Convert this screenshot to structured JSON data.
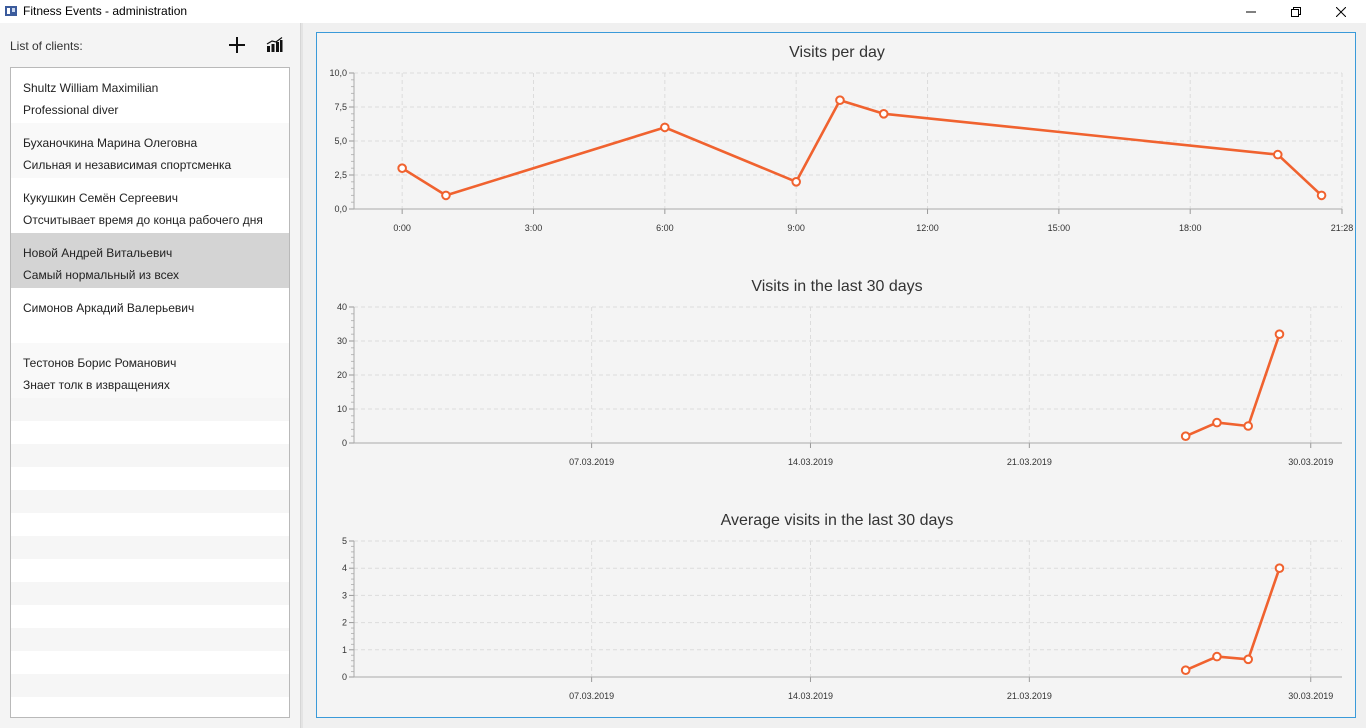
{
  "window": {
    "title": "Fitness Events - administration",
    "icon": "app-icon"
  },
  "sidebar": {
    "label": "List of clients:",
    "add_icon": "plus-icon",
    "stats_icon": "bar-chart-icon",
    "clients": [
      {
        "name": "Shultz William Maximilian",
        "note": "Professional diver",
        "selected": false
      },
      {
        "name": "Буханочкина Марина Олеговна",
        "note": "Сильная и независимая спортсменка",
        "selected": false
      },
      {
        "name": "Кукушкин Семён Сергеевич",
        "note": "Отсчитывает время до конца рабочего дня",
        "selected": false
      },
      {
        "name": "Новой Андрей Витальевич",
        "note": "Самый нормальный из всех",
        "selected": true
      },
      {
        "name": "Симонов Аркадий Валерьевич",
        "note": "",
        "selected": false
      },
      {
        "name": "Тестонов Борис Романович",
        "note": "Знает толк в извращениях",
        "selected": false
      }
    ]
  },
  "colors": {
    "series": "#f0622f",
    "panel_border": "#3a9ad9",
    "selected_row": "#d4d4d4"
  },
  "chart_data": [
    {
      "type": "line",
      "title": "Visits per day",
      "x_kind": "time",
      "x": [
        "0:00",
        "1:00",
        "6:00",
        "9:00",
        "10:00",
        "11:00",
        "20:00",
        "21:00"
      ],
      "y": [
        3,
        1,
        6,
        2,
        8,
        7,
        4,
        1
      ],
      "x_ticks": [
        "0:00",
        "3:00",
        "6:00",
        "9:00",
        "12:00",
        "15:00",
        "18:00",
        "21:28"
      ],
      "y_ticks": [
        "0,0",
        "2,5",
        "5,0",
        "7,5",
        "10,0"
      ],
      "ylim": [
        0,
        10
      ],
      "grid": true
    },
    {
      "type": "line",
      "title": "Visits in the last 30 days",
      "x_kind": "date",
      "x": [
        "2019-03-26",
        "2019-03-27",
        "2019-03-28",
        "2019-03-29"
      ],
      "y": [
        2,
        6,
        5,
        32
      ],
      "x_ticks": [
        "07.03.2019",
        "14.03.2019",
        "21.03.2019",
        "30.03.2019"
      ],
      "y_ticks": [
        "0",
        "10",
        "20",
        "30",
        "40"
      ],
      "ylim": [
        0,
        40
      ],
      "grid": true
    },
    {
      "type": "line",
      "title": "Average visits in the last 30 days",
      "x_kind": "date",
      "x": [
        "2019-03-26",
        "2019-03-27",
        "2019-03-28",
        "2019-03-29"
      ],
      "y": [
        0.25,
        0.75,
        0.65,
        4
      ],
      "x_ticks": [
        "07.03.2019",
        "14.03.2019",
        "21.03.2019",
        "30.03.2019"
      ],
      "y_ticks": [
        "0",
        "1",
        "2",
        "3",
        "4",
        "5"
      ],
      "ylim": [
        0,
        5
      ],
      "grid": true
    }
  ]
}
